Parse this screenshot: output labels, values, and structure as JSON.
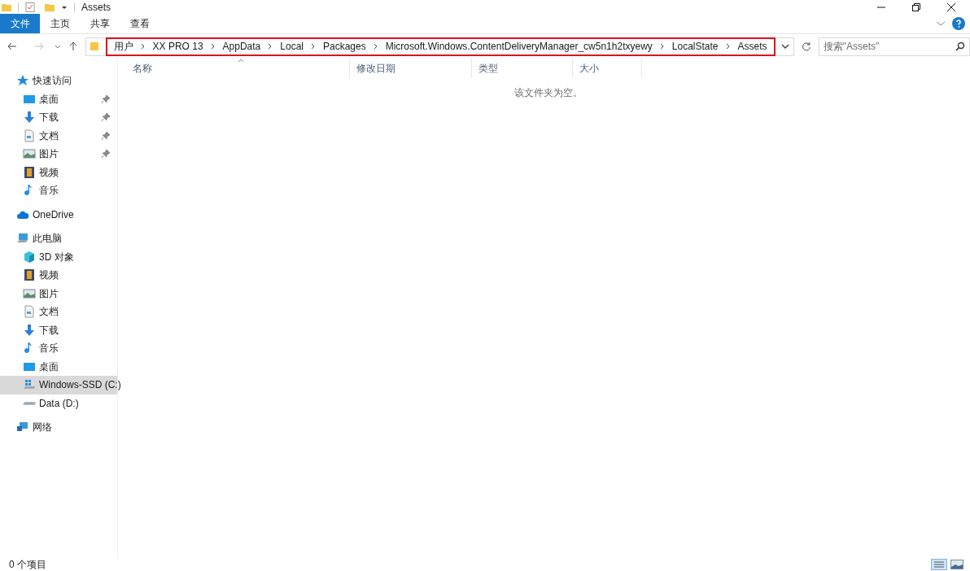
{
  "window": {
    "title": "Assets"
  },
  "ribbon_tabs": [
    {
      "label": "文件",
      "selected": true
    },
    {
      "label": "主页",
      "selected": false
    },
    {
      "label": "共享",
      "selected": false
    },
    {
      "label": "查看",
      "selected": false
    }
  ],
  "breadcrumbs": [
    "用户",
    "XX PRO 13",
    "AppData",
    "Local",
    "Packages",
    "Microsoft.Windows.ContentDeliveryManager_cw5n1h2txyewy",
    "LocalState",
    "Assets"
  ],
  "search": {
    "placeholder": "搜索\"Assets\""
  },
  "sidebar": {
    "items": [
      {
        "label": "快速访问",
        "kind": "star",
        "selected": false,
        "children": [
          {
            "label": "桌面",
            "kind": "desktop",
            "pinned": true,
            "selected": false
          },
          {
            "label": "下载",
            "kind": "download",
            "pinned": true,
            "selected": false
          },
          {
            "label": "文档",
            "kind": "document",
            "pinned": true,
            "selected": false
          },
          {
            "label": "图片",
            "kind": "picture",
            "pinned": true,
            "selected": false
          },
          {
            "label": "视频",
            "kind": "video",
            "pinned": false,
            "selected": false
          },
          {
            "label": "音乐",
            "kind": "music",
            "pinned": false,
            "selected": false
          }
        ]
      },
      {
        "label": "OneDrive",
        "kind": "cloud",
        "selected": false
      },
      {
        "label": "此电脑",
        "kind": "computer",
        "selected": false,
        "children": [
          {
            "label": "3D 对象",
            "kind": "cube",
            "pinned": false,
            "selected": false
          },
          {
            "label": "视频",
            "kind": "video",
            "pinned": false,
            "selected": false
          },
          {
            "label": "图片",
            "kind": "picture",
            "pinned": false,
            "selected": false
          },
          {
            "label": "文档",
            "kind": "document",
            "pinned": false,
            "selected": false
          },
          {
            "label": "下载",
            "kind": "download",
            "pinned": false,
            "selected": false
          },
          {
            "label": "音乐",
            "kind": "music",
            "pinned": false,
            "selected": false
          },
          {
            "label": "桌面",
            "kind": "desktop",
            "pinned": false,
            "selected": false
          },
          {
            "label": "Windows-SSD (C:)",
            "kind": "system-drive",
            "pinned": false,
            "selected": true
          },
          {
            "label": "Data (D:)",
            "kind": "drive",
            "pinned": false,
            "selected": false
          }
        ]
      },
      {
        "label": "网络",
        "kind": "network",
        "selected": false
      }
    ]
  },
  "table": {
    "columns": [
      {
        "label": "名称",
        "sorted": true
      },
      {
        "label": "修改日期",
        "sorted": false
      },
      {
        "label": "类型",
        "sorted": false
      },
      {
        "label": "大小",
        "sorted": false
      }
    ],
    "empty_message": "该文件夹为空。"
  },
  "status_bar": {
    "item_count": "0 个项目"
  }
}
